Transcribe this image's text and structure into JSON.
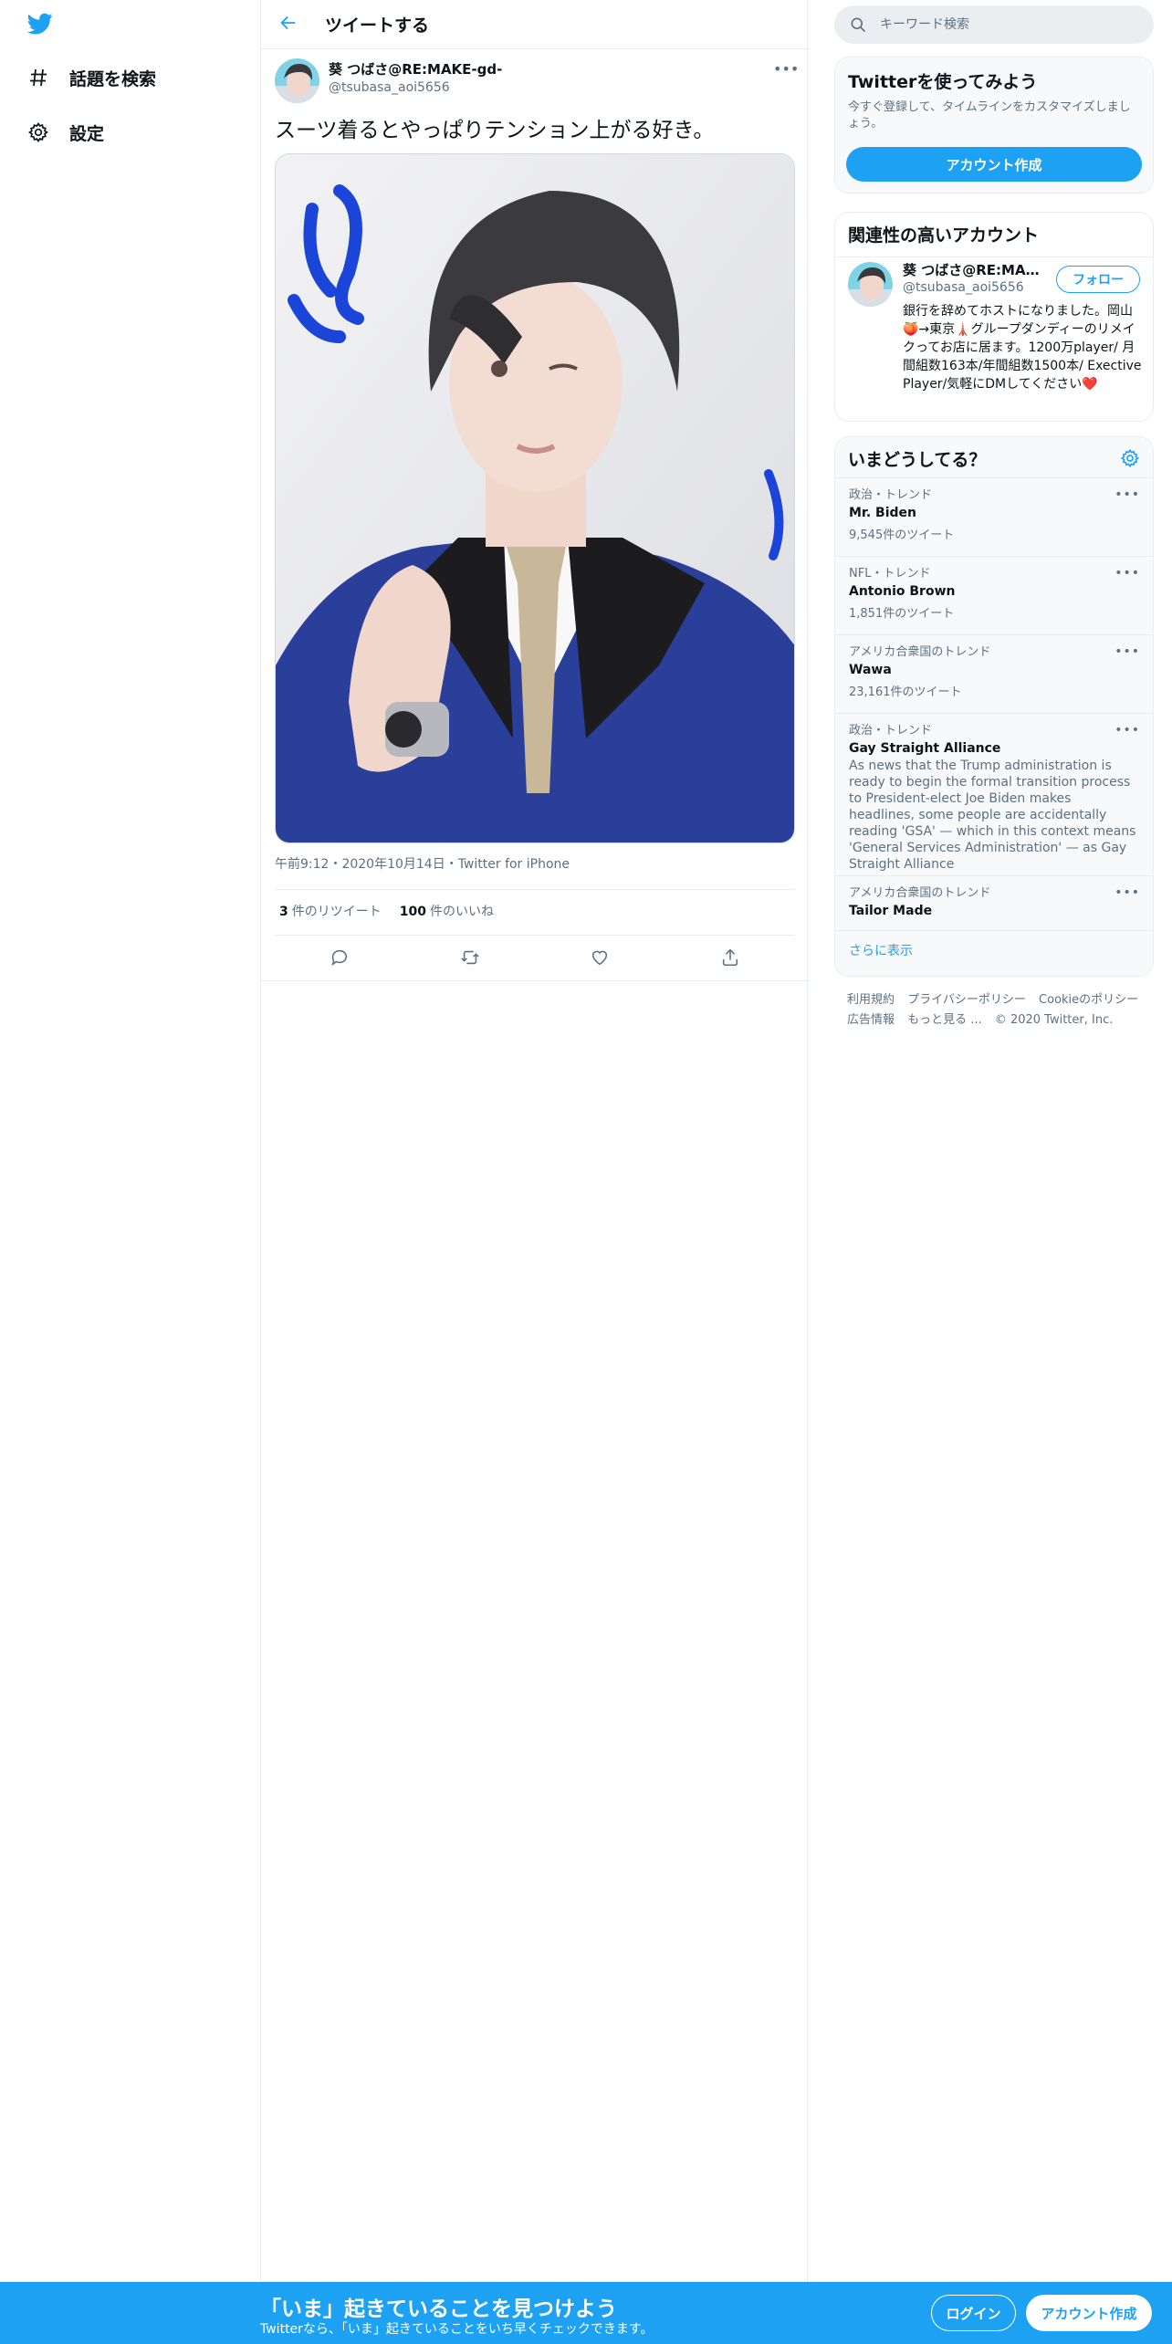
{
  "nav": {
    "logo": "twitter-bird-icon",
    "items": [
      {
        "icon": "hashtag-icon",
        "label": "話題を検索"
      },
      {
        "icon": "gear-icon",
        "label": "設定"
      }
    ]
  },
  "header": {
    "back_icon": "arrow-left-icon",
    "title": "ツイートする"
  },
  "tweet": {
    "author_name": "葵 つばさ@RE:MAKE-gd-",
    "author_handle": "@tsubasa_aoi5656",
    "text": "スーツ着るとやっぱりテンション上がる好き。",
    "timestamp": "午前9:12・2020年10月14日・Twitter for iPhone",
    "retweets_count": "3",
    "retweets_label": "件のリツイート",
    "likes_count": "100",
    "likes_label": "件のいいね",
    "actions": [
      "reply-icon",
      "retweet-icon",
      "like-icon",
      "share-icon"
    ]
  },
  "search": {
    "placeholder": "キーワード検索"
  },
  "signup_card": {
    "title": "Twitterを使ってみよう",
    "subtitle": "今すぐ登録して、タイムラインをカスタマイズしましょう。",
    "button": "アカウント作成"
  },
  "related": {
    "title": "関連性の高いアカウント",
    "name": "葵 つばさ@RE:MAK...",
    "handle": "@tsubasa_aoi5656",
    "follow": "フォロー",
    "bio": "銀行を辞めてホストになりました。岡山🍑→東京🗼グループダンディーのリメイクってお店に居ます。1200万player/ 月間組数163本/年間組数1500本/ Exective Player/気軽にDMしてください❤️"
  },
  "trends": {
    "title": "いまどうしてる？",
    "items": [
      {
        "category": "政治・トレンド",
        "name": "Mr. Biden",
        "count": "9,545件のツイート",
        "desc": ""
      },
      {
        "category": "NFL・トレンド",
        "name": "Antonio Brown",
        "count": "1,851件のツイート",
        "desc": ""
      },
      {
        "category": "アメリカ合衆国のトレンド",
        "name": "Wawa",
        "count": "23,161件のツイート",
        "desc": ""
      },
      {
        "category": "政治・トレンド",
        "name": "Gay Straight Alliance",
        "count": "",
        "desc": "As news that the Trump administration is ready to begin the formal transition process to President-elect Joe Biden makes headlines, some people are accidentally reading 'GSA' — which in this context means 'General Services Administration' — as Gay Straight Alliance"
      },
      {
        "category": "アメリカ合衆国のトレンド",
        "name": "Tailor Made",
        "count": "",
        "desc": ""
      }
    ],
    "show_more": "さらに表示"
  },
  "footer": {
    "links1": [
      "利用規約",
      "プライバシーポリシー",
      "Cookieのポリシー"
    ],
    "links2": [
      "広告情報",
      "もっと見る ..."
    ],
    "copyright": "© 2020 Twitter, Inc."
  },
  "bottom_bar": {
    "title": "「いま」起きていることを見つけよう",
    "subtitle": "Twitterなら、「いま」起きていることをいち早くチェックできます。",
    "login": "ログイン",
    "signup": "アカウント作成"
  },
  "colors": {
    "accent": "#1da1f2",
    "text": "#0f1419",
    "muted": "#5b7083",
    "border": "#e6ecf0"
  }
}
